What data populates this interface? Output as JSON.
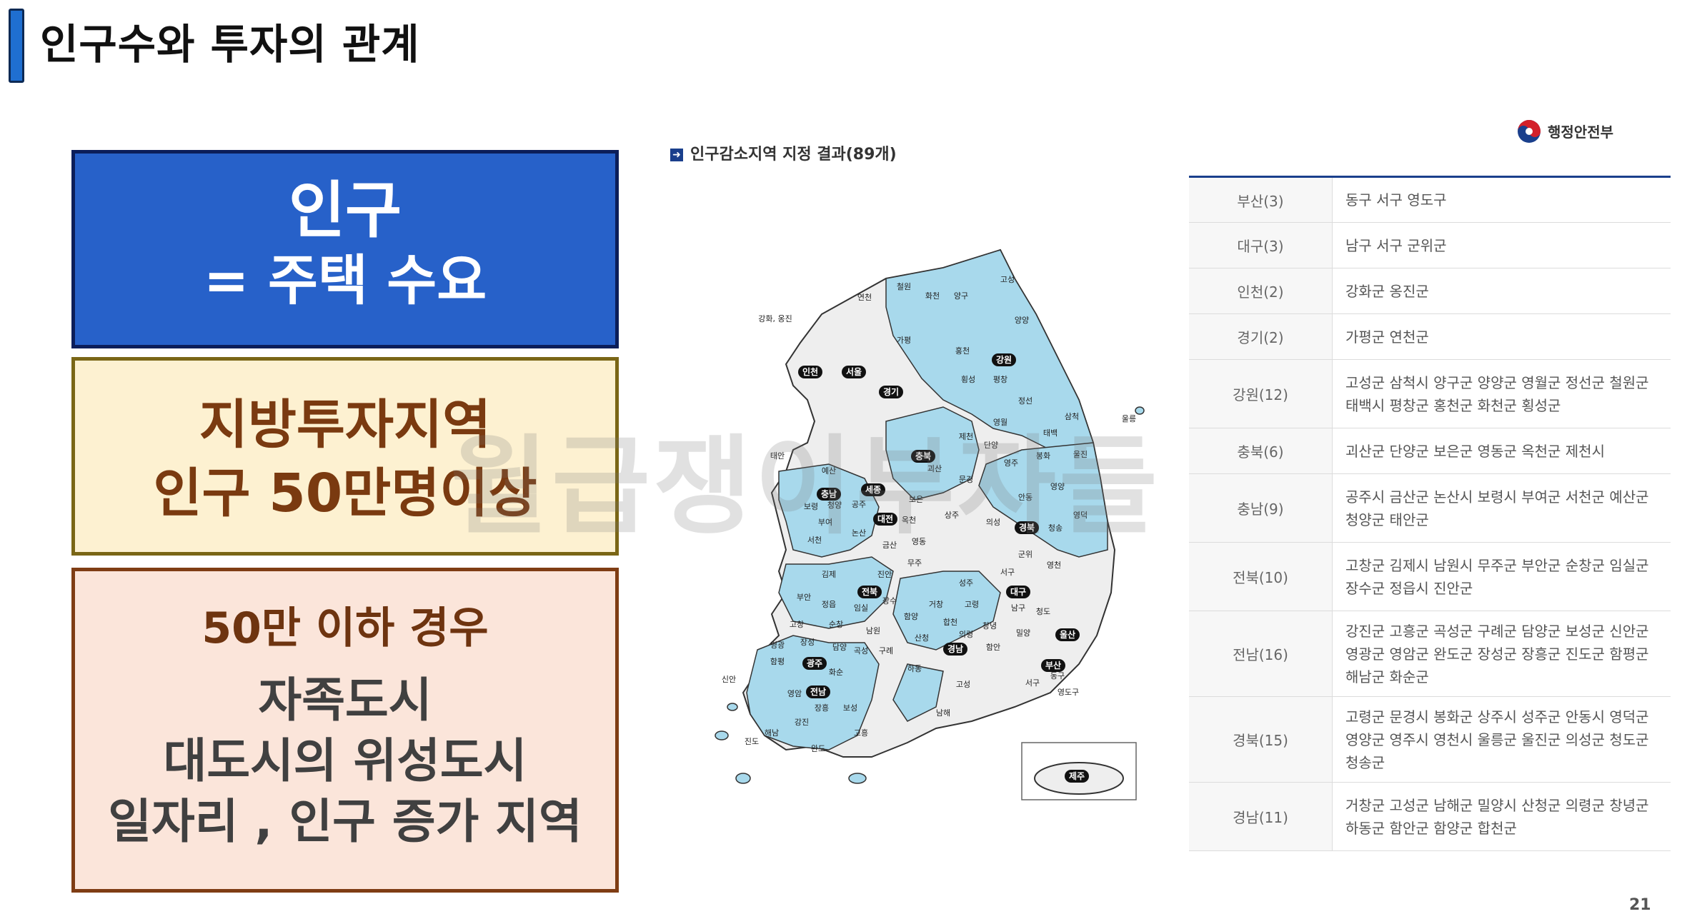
{
  "slide": {
    "title": "인구수와 투자의 관계",
    "page_number": "21"
  },
  "boxes": {
    "population": {
      "line1": "인구",
      "line2": "= 주택 수요"
    },
    "regional": {
      "line1": "지방투자지역",
      "line2": "인구 50만명이상"
    },
    "under": {
      "subtitle": "50만 이하 경우",
      "line1": "자족도시",
      "line2": "대도시의 위성도시",
      "line3": "일자리 , 인구 증가 지역"
    }
  },
  "map": {
    "caption": "인구감소지역 지정 결과(89개)",
    "ministry": "행정안전부",
    "labels": {
      "incheon": "인천",
      "seoul": "서울",
      "gyeonggi": "경기",
      "gangwon": "강원",
      "chungbuk": "충북",
      "chungnam": "충남",
      "sejong": "세종",
      "daejeon": "대전",
      "jeonbuk": "전북",
      "gyeongbuk": "경북",
      "daegu": "대구",
      "ulsan": "울산",
      "gwangju": "광주",
      "gyeongnam": "경남",
      "busan": "부산",
      "jeonnam": "전남",
      "jeju": "제주",
      "ganghwa": "강화, 옹진",
      "goseong_n": "고성",
      "yanggu": "양구",
      "hwacheon": "화천",
      "cheorwon": "철원",
      "yeoncheon": "연천",
      "gapyeong": "가평",
      "yangyang": "양양",
      "hongcheon": "홍천",
      "hoengseong": "횡성",
      "pyeongchang": "평창",
      "jeongseon": "정선",
      "samcheok": "삼척",
      "taebaek": "태백",
      "yeongwol": "영월",
      "jecheon": "제천",
      "danyang": "단양",
      "uljin": "울진",
      "bonghwa": "봉화",
      "yeongju": "영주",
      "ulleung": "울릉",
      "taean": "태안",
      "yesan": "예산",
      "goesan": "괴산",
      "mungyeong": "문경",
      "andong": "안동",
      "yeongyang": "영양",
      "yeongdeok": "영덕",
      "cheongsong": "청송",
      "uiseong": "의성",
      "sangju": "상주",
      "boeun": "보은",
      "okcheon": "옥천",
      "yeongdong": "영동",
      "boryeong": "보령",
      "cheongyang": "청양",
      "gongju": "공주",
      "buyeo": "부여",
      "nonsan": "논산",
      "seocheon": "서천",
      "geumsan": "금산",
      "muju": "무주",
      "jinan": "진안",
      "gimje": "김제",
      "buan": "부안",
      "jeongeup": "정읍",
      "imsil": "임실",
      "jangsu": "장수",
      "gochang": "고창",
      "sunchang": "순창",
      "namwon": "남원",
      "hamyang": "함양",
      "geochang": "거창",
      "hapcheon": "합천",
      "seongju": "성주",
      "goryeong": "고령",
      "gunwi": "군위",
      "yeongcheon": "영천",
      "cheongdo": "청도",
      "changnyeong": "창녕",
      "miryang": "밀양",
      "uiryeong": "의령",
      "haman": "함안",
      "sancheong": "산청",
      "hadong": "하동",
      "goseong_s": "고성",
      "namhae": "남해",
      "yeonggwang": "영광",
      "jangseong": "장성",
      "damyang": "담양",
      "gokseong": "곡성",
      "gurye": "구례",
      "hampyeong": "함평",
      "hwasun": "화순",
      "yeongam": "영암",
      "jangheung": "장흥",
      "boseong": "보성",
      "gangjin": "강진",
      "haenam": "해남",
      "wando": "완도",
      "goheung": "고흥",
      "jindo": "진도",
      "sinan": "신안",
      "seogu": "서구",
      "donggu": "동구",
      "yeongdo": "영도구",
      "daegu_seo": "서구",
      "daegu_nam": "남구"
    }
  },
  "table": {
    "rows": [
      {
        "region": "부산(3)",
        "areas": "동구 서구 영도구"
      },
      {
        "region": "대구(3)",
        "areas": "남구 서구 군위군"
      },
      {
        "region": "인천(2)",
        "areas": "강화군 옹진군"
      },
      {
        "region": "경기(2)",
        "areas": "가평군 연천군"
      },
      {
        "region": "강원(12)",
        "areas": "고성군 삼척시 양구군 양양군 영월군 정선군 철원군 태백시 평창군 홍천군 화천군 횡성군"
      },
      {
        "region": "충북(6)",
        "areas": "괴산군 단양군 보은군 영동군 옥천군 제천시"
      },
      {
        "region": "충남(9)",
        "areas": "공주시 금산군 논산시 보령시 부여군 서천군 예산군 청양군 태안군"
      },
      {
        "region": "전북(10)",
        "areas": "고창군 김제시 남원시 무주군 부안군 순창군 임실군 장수군 정읍시 진안군"
      },
      {
        "region": "전남(16)",
        "areas": "강진군 고흥군 곡성군 구례군 담양군 보성군 신안군 영광군 영암군 완도군 장성군 장흥군 진도군 함평군 해남군 화순군"
      },
      {
        "region": "경북(15)",
        "areas": "고령군 문경시 봉화군 상주시 성주군 안동시 영덕군 영양군 영주시 영천시 울릉군 울진군 의성군 청도군 청송군"
      },
      {
        "region": "경남(11)",
        "areas": "거창군 고성군 남해군 밀양시 산청군 의령군 창녕군 하동군 함안군 함양군 합천군"
      }
    ]
  },
  "watermark": "월급쟁이부자들",
  "colors": {
    "decline_region": "#a8d9ec",
    "other_region": "#eeeeee",
    "box1_bg": "#2761c9",
    "box2_bg": "#fdf1d1",
    "box3_bg": "#fbe5da"
  }
}
